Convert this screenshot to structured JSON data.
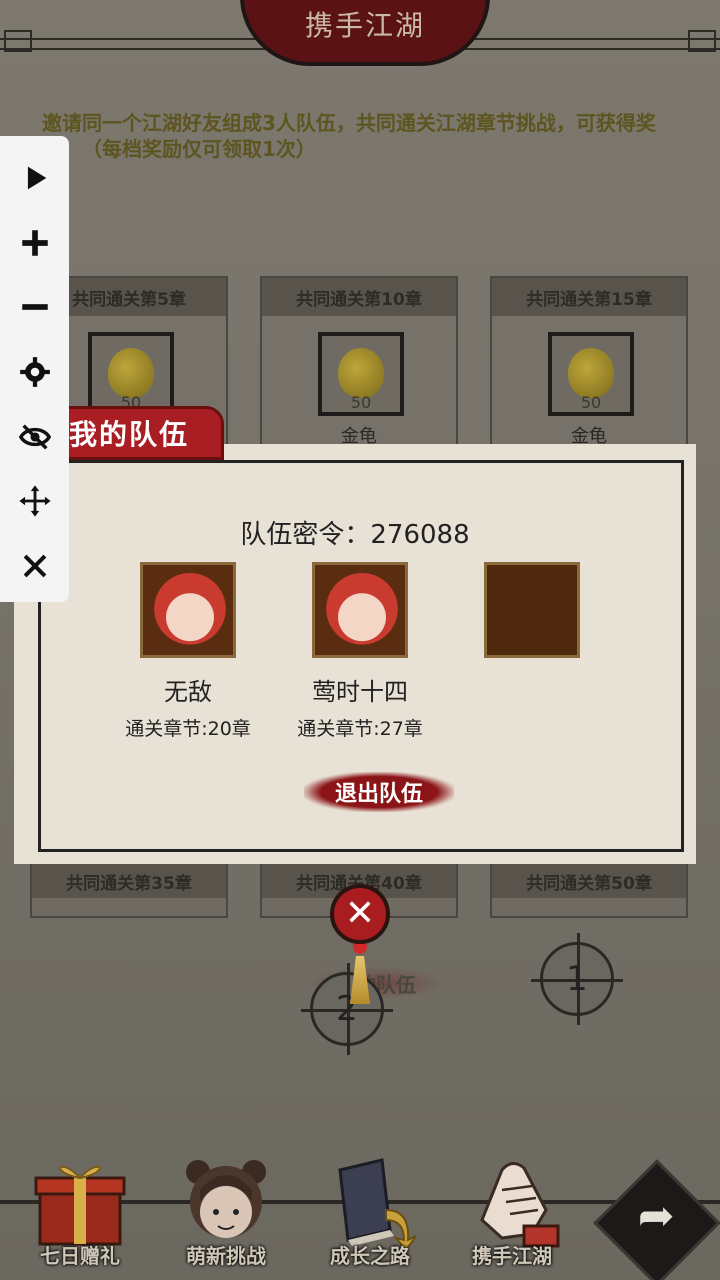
{
  "header": {
    "title": "携手江湖"
  },
  "invite_text": "邀请同一个江湖好友组成3人队伍，共同通关江湖章节挑战，可获得奖励！（每档奖励仅可领取1次）",
  "reward_cards": [
    {
      "title": "共同通关第5章",
      "count": "50",
      "item": "金龟",
      "icon": "gourd-icon"
    },
    {
      "title": "共同通关第10章",
      "count": "50",
      "item": "金龟",
      "icon": "gourd-icon"
    },
    {
      "title": "共同通关第15章",
      "count": "50",
      "item": "金龟",
      "icon": "gourd-icon"
    }
  ],
  "lower_cards": [
    {
      "title": "共同通关第35章"
    },
    {
      "title": "共同通关第40章"
    },
    {
      "title": "共同通关第50章"
    }
  ],
  "toolbar": {
    "items": [
      "play-icon",
      "plus-icon",
      "minus-icon",
      "gear-icon",
      "eye-off-icon",
      "move-icon",
      "close-icon"
    ]
  },
  "team": {
    "tab_label": "我的队伍",
    "password_line": "队伍密令：276088",
    "members": [
      {
        "name": "无敌",
        "stage": "通关章节:20章",
        "avatar": "red-hair-avatar"
      },
      {
        "name": "莺时十四",
        "stage": "通关章节:27章",
        "avatar": "red-hair-avatar"
      }
    ],
    "empty_slot": "empty-slot",
    "leave_button": "退出队伍"
  },
  "widgets": {
    "ghost_label": "我的队伍",
    "marker_1": "1",
    "marker_2": "2",
    "close_glyph": "✕"
  },
  "bottom_nav": [
    {
      "label": "七日赠礼",
      "icon": "gift-box-icon"
    },
    {
      "label": "萌新挑战",
      "icon": "girl-character-icon"
    },
    {
      "label": "成长之路",
      "icon": "book-icon"
    },
    {
      "label": "携手江湖",
      "icon": "handshake-icon"
    }
  ],
  "share_button": {
    "icon": "share-arrow-icon",
    "glyph": "➦"
  },
  "colors": {
    "accent_red": "#a81e22",
    "title_dark_red": "#5a1214",
    "panel_paper": "#e8e2d6"
  }
}
